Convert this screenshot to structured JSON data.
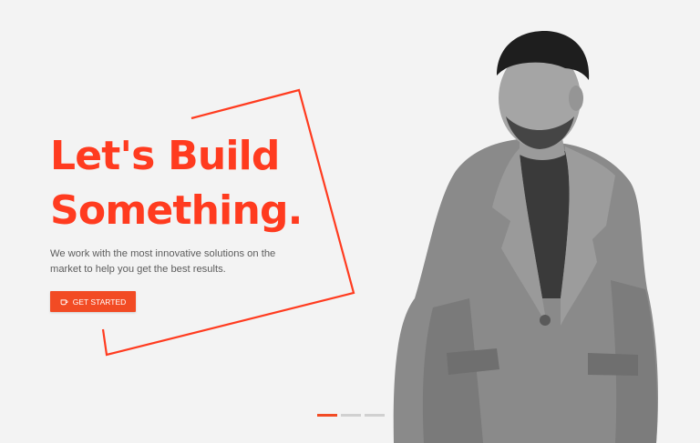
{
  "hero": {
    "headline_line1": "Let's Build",
    "headline_line2": "Something.",
    "subtitle": "We work with the most innovative solutions on the market to help you get the best results.",
    "cta_label": "GET STARTED",
    "cta_icon": "coffee-cup-icon"
  },
  "slider": {
    "total_slides": 3,
    "active_slide": 1
  },
  "colors": {
    "accent": "#ff3b1f",
    "button": "#f24b24",
    "background": "#f3f3f3",
    "text_muted": "#5c5c5c"
  }
}
